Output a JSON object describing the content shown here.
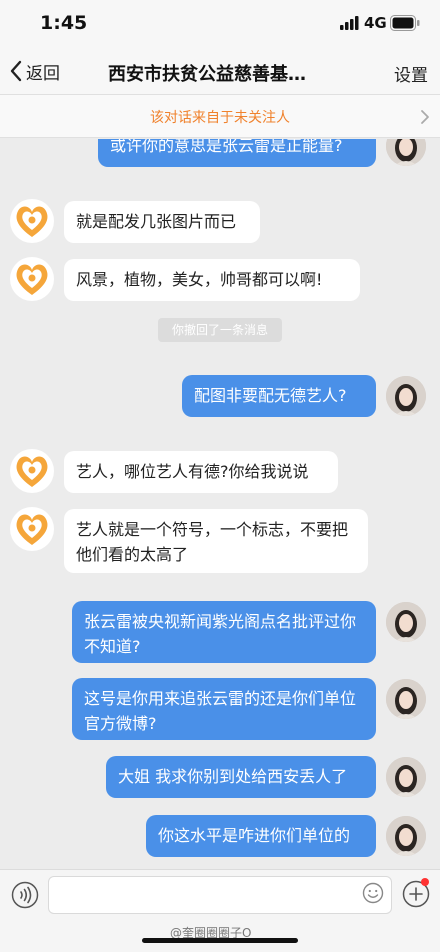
{
  "status_bar": {
    "time": "1:45",
    "network": "4G"
  },
  "nav": {
    "back_label": "返回",
    "title": "西安市扶贫公益慈善基…",
    "settings_label": "设置"
  },
  "notice": {
    "text": "该对话来自于未关注人"
  },
  "messages": [
    {
      "side": "right",
      "text": "或许你的意思是张云雷是正能量?"
    },
    {
      "side": "left",
      "text": "就是配发几张图片而已"
    },
    {
      "side": "left",
      "text": "风景，植物，美女，帅哥都可以啊!"
    },
    {
      "side": "system",
      "text": "你撤回了一条消息"
    },
    {
      "side": "right",
      "text": "配图非要配无德艺人?"
    },
    {
      "side": "left",
      "text": "艺人，哪位艺人有德?你给我说说"
    },
    {
      "side": "left",
      "text": "艺人就是一个符号，一个标志，不要把他们看的太高了"
    },
    {
      "side": "right",
      "text": "张云雷被央视新闻紫光阁点名批评过你不知道?"
    },
    {
      "side": "right",
      "text": "这号是你用来追张云雷的还是你们单位官方微博?"
    },
    {
      "side": "right",
      "text": "大姐 我求你别到处给西安丢人了"
    },
    {
      "side": "right",
      "text": "你这水平是咋进你们单位的"
    }
  ],
  "input": {
    "placeholder": ""
  },
  "watermark": "@奎圈圈圈子O",
  "icons": {
    "back": "chevron-left-icon",
    "notice": "chevron-right-icon",
    "voice": "voice-icon",
    "emoji": "smiley-icon",
    "plus": "plus-icon"
  },
  "colors": {
    "accent": "#4a90e8",
    "notice": "#f0822d",
    "org_avatar": "#f5a63a"
  }
}
